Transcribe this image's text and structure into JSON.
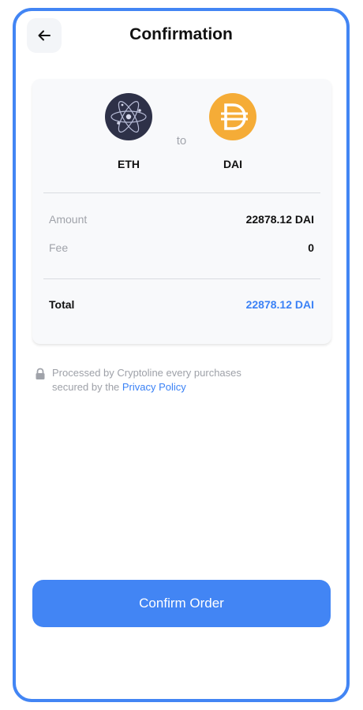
{
  "header": {
    "title": "Confirmation",
    "back_icon": "arrow-left-icon"
  },
  "conversion": {
    "from": {
      "symbol": "ETH",
      "icon": "atom-icon",
      "color": "#2e3148"
    },
    "connector": "to",
    "to": {
      "symbol": "DAI",
      "icon": "dai-icon",
      "color": "#f5ac37"
    }
  },
  "details": {
    "amount_label": "Amount",
    "amount_value": "22878.12 DAI",
    "fee_label": "Fee",
    "fee_value": "0",
    "total_label": "Total",
    "total_value": "22878.12 DAI"
  },
  "notice": {
    "text_line1": "Processed by Cryptoline every purchases",
    "text_line2_prefix": "secured by the ",
    "link_text": "Privacy Policy",
    "icon": "lock-icon"
  },
  "actions": {
    "confirm_label": "Confirm Order"
  },
  "theme": {
    "accent": "#4285f4",
    "link": "#3b82f6"
  }
}
